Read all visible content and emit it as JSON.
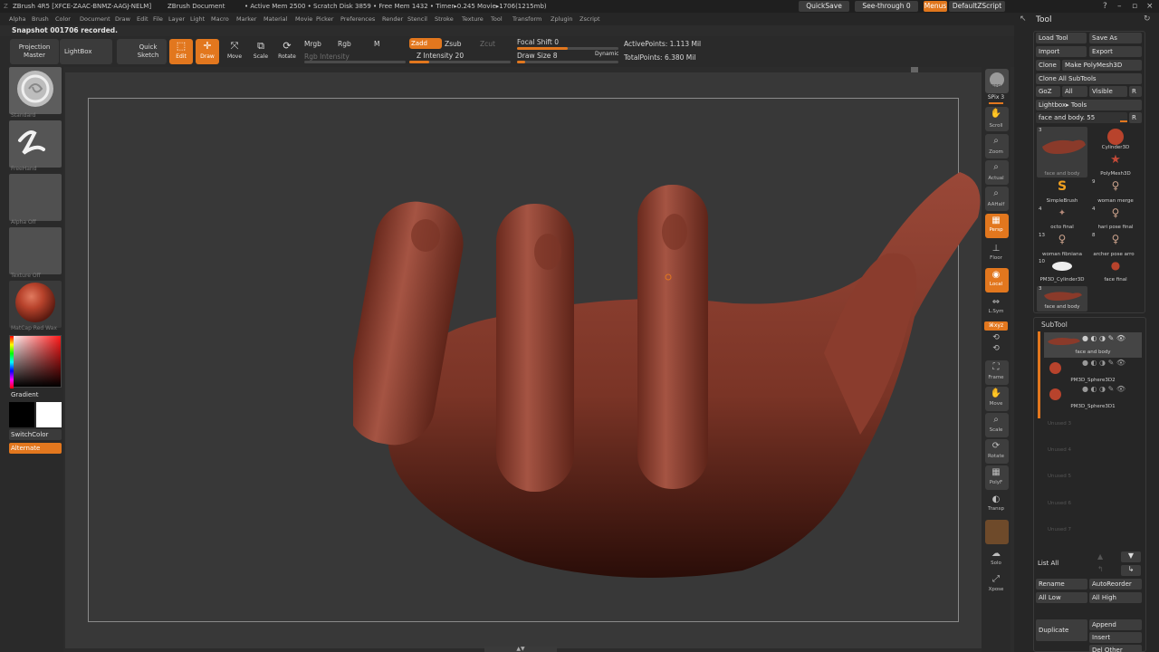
{
  "titlebar": {
    "app": "ZBrush 4R5 [XFCE-ZAAC-BNMZ-AAGJ-NELM]",
    "doc": "ZBrush Document",
    "stats": "• Active Mem 2500 • Scratch Disk 3859 • Free Mem 1432 • Timer▸0.245 Movie▸1706(1215mb)",
    "quicksave": "QuickSave",
    "seethrough": "See-through  0",
    "menus": "Menus",
    "defaultzscript": "DefaultZScript"
  },
  "menus": [
    "Alpha",
    "Brush",
    "Color",
    "Document",
    "Draw",
    "Edit",
    "File",
    "Layer",
    "Light",
    "Macro",
    "Marker",
    "Material",
    "Movie",
    "Picker",
    "Preferences",
    "Render",
    "Stencil",
    "Stroke",
    "Texture",
    "Tool",
    "Transform",
    "Zplugin",
    "Zscript"
  ],
  "notification": "Snapshot 001706 recorded.",
  "toolbar": {
    "projection_master": "Projection\nMaster",
    "lightbox": "LightBox",
    "quick_sketch": "Quick\nSketch",
    "edit": "Edit",
    "draw": "Draw",
    "move": "Move",
    "scale": "Scale",
    "rotate": "Rotate",
    "mrgb": "Mrgb",
    "rgb": "Rgb",
    "m": "M",
    "rgb_intensity": "Rgb Intensity",
    "zadd": "Zadd",
    "zsub": "Zsub",
    "zcut": "Zcut",
    "z_intensity": "Z Intensity 20",
    "focal_shift": "Focal Shift 0",
    "draw_size": "Draw Size 8",
    "dynamic": "Dynamic",
    "active_points": "ActivePoints: 1.113 Mil",
    "total_points": "TotalPoints: 6.380 Mil",
    "z_intensity_level": 0.2,
    "focal_shift_level": 0.5,
    "draw_size_level": 0.08
  },
  "leftshelf": {
    "brush": "Standard",
    "stroke": "FreeHand",
    "alpha": "Alpha  Off",
    "texture": "Texture  Off",
    "material": "MatCap Red Wax",
    "gradient": "Gradient",
    "switchcolor": "SwitchColor",
    "alternate": "Alternate"
  },
  "rightshelf": {
    "bpr": "BPR",
    "spix": "SPix 3",
    "scroll": "Scroll",
    "zoom": "Zoom",
    "actual": "Actual",
    "aahalf": "AAHalf",
    "persp": "Persp",
    "floor": "Floor",
    "local": "Local",
    "lsym": "L.Sym",
    "xyz": "⌘xyz",
    "frame": "Frame",
    "move": "Move",
    "scale": "Scale",
    "rotate": "Rotate",
    "polyf": "PolyF",
    "transp": "Transp",
    "solo": "Solo",
    "xpose": "Xpose"
  },
  "toolpanel": {
    "title": "Tool",
    "load_tool": "Load Tool",
    "save_as": "Save As",
    "import": "Import",
    "export": "Export",
    "clone": "Clone",
    "make_polymesh": "Make PolyMesh3D",
    "clone_all": "Clone All SubTools",
    "goz": "GoZ",
    "all": "All",
    "visible": "Visible",
    "r": "R",
    "lightbox_tools": "Lightbox▸ Tools",
    "current_tool": "face and body. 55",
    "tools": [
      {
        "name": "face and body",
        "count": "3"
      },
      {
        "name": "Cylinder3D",
        "count": ""
      },
      {
        "name": "PolyMesh3D",
        "count": ""
      },
      {
        "name": "SimpleBrush",
        "count": ""
      },
      {
        "name": "woman merge",
        "count": "9"
      },
      {
        "name": "octo final",
        "count": "4"
      },
      {
        "name": "hari pose final",
        "count": "4"
      },
      {
        "name": "woman fibniana",
        "count": "13"
      },
      {
        "name": "archer pose arro",
        "count": "8"
      },
      {
        "name": "PM3D_Cylinder3D",
        "count": "10"
      },
      {
        "name": "face final",
        "count": ""
      },
      {
        "name": "face and body",
        "count": "3"
      }
    ],
    "subtool_title": "SubTool",
    "subtools": [
      "face and body",
      "PM3D_Sphere3D2",
      "PM3D_Sphere3D1"
    ],
    "unused": [
      "Unused 3",
      "Unused 4",
      "Unused 5",
      "Unused 6",
      "Unused 7"
    ],
    "list_all": "List All",
    "rename": "Rename",
    "autoreorder": "AutoReorder",
    "all_low": "All Low",
    "all_high": "All High",
    "duplicate": "Duplicate",
    "append": "Append",
    "insert": "Insert",
    "del_other": "Del Other"
  },
  "colors": {
    "accent": "#e2771e",
    "skin": "#7a3426",
    "panel": "#262626"
  }
}
